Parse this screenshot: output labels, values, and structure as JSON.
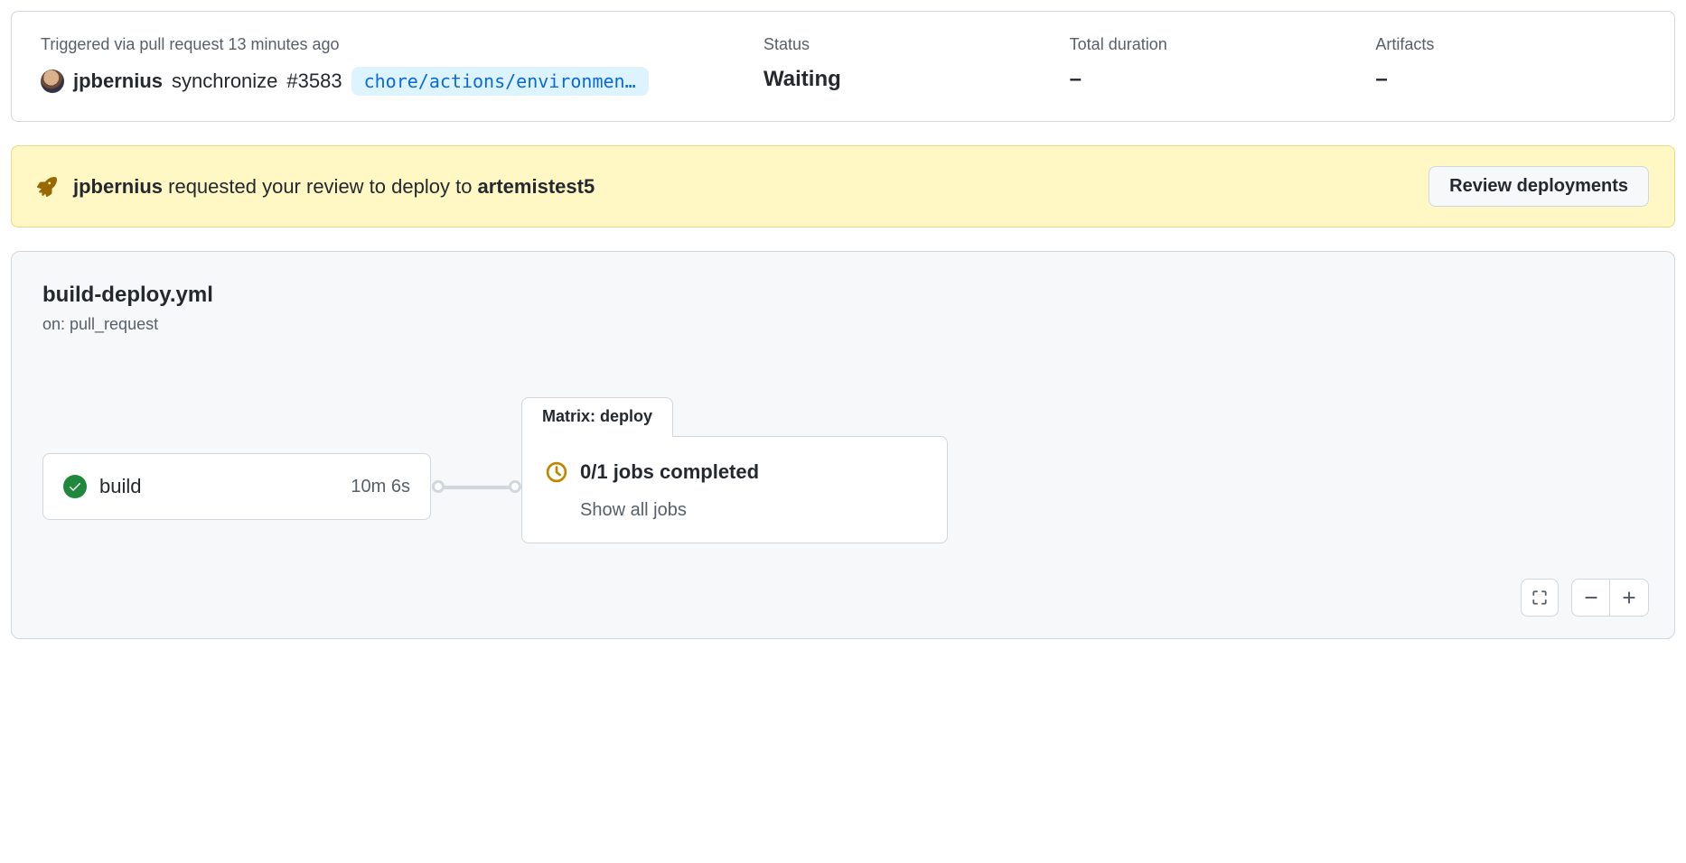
{
  "summary": {
    "trigger_line": "Triggered via pull request 13 minutes ago",
    "actor": "jpbernius",
    "action": "synchronize",
    "pr_ref": "#3583",
    "branch": "chore/actions/environmen…",
    "status_label": "Status",
    "status_value": "Waiting",
    "duration_label": "Total duration",
    "duration_value": "–",
    "artifacts_label": "Artifacts",
    "artifacts_value": "–"
  },
  "banner": {
    "actor": "jpbernius",
    "middle": " requested your review to deploy to ",
    "env": "artemistest5",
    "button": "Review deployments"
  },
  "workflow": {
    "file": "build-deploy.yml",
    "on": "on: pull_request",
    "build": {
      "name": "build",
      "duration": "10m 6s"
    },
    "matrix": {
      "tab": "Matrix: deploy",
      "status": "0/1 jobs completed",
      "link": "Show all jobs"
    }
  }
}
